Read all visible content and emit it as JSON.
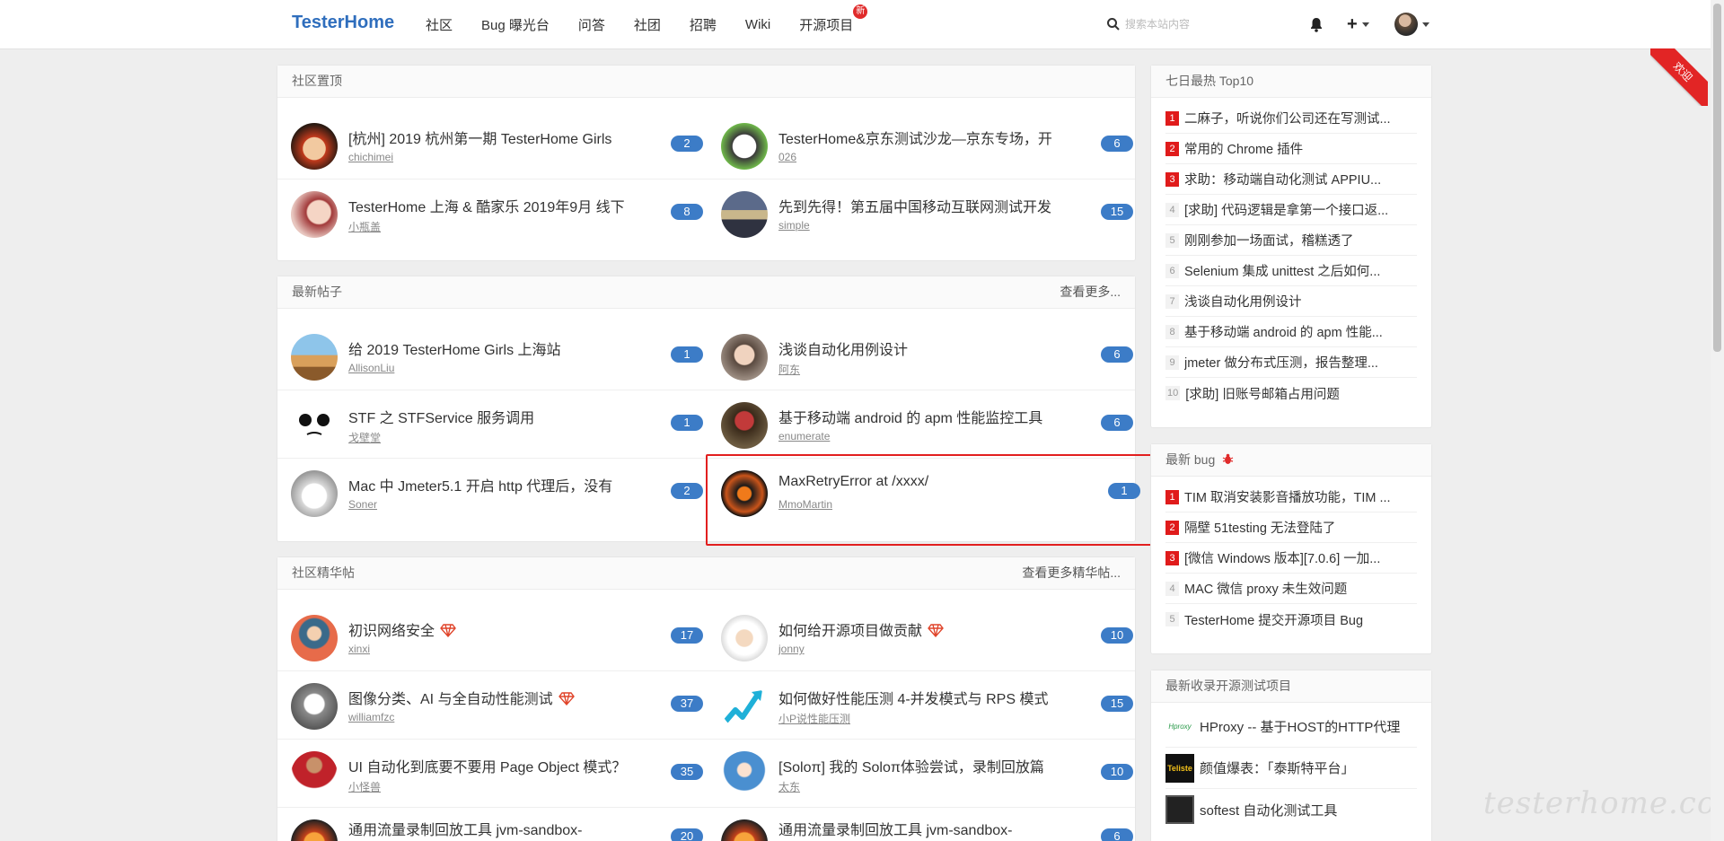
{
  "navbar": {
    "brand": "TesterHome",
    "items": [
      "社区",
      "Bug 曝光台",
      "问答",
      "社团",
      "招聘",
      "Wiki",
      "开源项目"
    ],
    "new_badge": "新",
    "search_placeholder": "搜索本站内容"
  },
  "pinned": {
    "title": "社区置顶",
    "topics": [
      {
        "title": "[杭州] 2019 杭州第一期 TesterHome Girls",
        "author": "chichimei",
        "count": "2"
      },
      {
        "title": "TesterHome&京东测试沙龙—京东专场，开",
        "author": "026",
        "count": "6"
      },
      {
        "title": "TesterHome 上海 & 酷家乐 2019年9月 线下",
        "author": "小瓶盖",
        "count": "8"
      },
      {
        "title": "先到先得！第五届中国移动互联网测试开发",
        "author": "simple",
        "count": "15"
      }
    ]
  },
  "latest": {
    "title": "最新帖子",
    "more": "查看更多...",
    "topics": [
      {
        "title": "给 2019 TesterHome Girls 上海站",
        "author": "AllisonLiu",
        "count": "1"
      },
      {
        "title": "浅谈自动化用例设计",
        "author": "阿东",
        "count": "6"
      },
      {
        "title": "STF 之 STFService 服务调用",
        "author": "戈壁堂",
        "count": "1"
      },
      {
        "title": "基于移动端 android 的 apm 性能监控工具",
        "author": "enumerate",
        "count": "6"
      },
      {
        "title": "Mac 中 Jmeter5.1 开启 http 代理后，没有",
        "author": "Soner",
        "count": "2"
      },
      {
        "title": "MaxRetryError at /xxxx/",
        "author": "MmoMartin",
        "count": "1"
      }
    ]
  },
  "excellent": {
    "title": "社区精华帖",
    "more": "查看更多精华帖...",
    "topics": [
      {
        "title": "初识网络安全",
        "author": "xinxi",
        "count": "17"
      },
      {
        "title": "如何给开源项目做贡献",
        "author": "jonny",
        "count": "10"
      },
      {
        "title": "图像分类、AI 与全自动性能测试",
        "author": "williamfzc",
        "count": "37"
      },
      {
        "title": "如何做好性能压测 4-并发模式与 RPS 模式",
        "author": "小P说性能压测",
        "count": "15"
      },
      {
        "title": "UI 自动化到底要不要用 Page Object 模式？",
        "author": "小怪兽",
        "count": "35"
      },
      {
        "title": "[Soloπ] 我的 Soloπ体验尝试，录制回放篇",
        "author": "太东",
        "count": "10"
      },
      {
        "title": "通用流量录制回放工具 jvm-sandbox-",
        "author": "",
        "count": "20"
      },
      {
        "title": "通用流量录制回放工具 jvm-sandbox-",
        "author": "",
        "count": "6"
      }
    ]
  },
  "top10": {
    "title": "七日最热 Top10",
    "items": [
      {
        "rank": "1",
        "text": "二麻子，听说你们公司还在写测试..."
      },
      {
        "rank": "2",
        "text": "常用的 Chrome 插件"
      },
      {
        "rank": "3",
        "text": "求助：移动端自动化测试 APPIU..."
      },
      {
        "rank": "4",
        "text": "[求助] 代码逻辑是拿第一个接口返..."
      },
      {
        "rank": "5",
        "text": "刚刚参加一场面试，稽糕透了"
      },
      {
        "rank": "6",
        "text": "Selenium 集成 unittest 之后如何..."
      },
      {
        "rank": "7",
        "text": "浅谈自动化用例设计"
      },
      {
        "rank": "8",
        "text": "基于移动端 android 的 apm 性能..."
      },
      {
        "rank": "9",
        "text": "jmeter 做分布式压测，报告整理..."
      },
      {
        "rank": "10",
        "text": "[求助] 旧账号邮箱占用问题"
      }
    ]
  },
  "bugs": {
    "title": "最新 bug",
    "items": [
      {
        "rank": "1",
        "text": "TIM 取消安装影音播放功能，TIM ..."
      },
      {
        "rank": "2",
        "text": "隔壁 51testing 无法登陆了"
      },
      {
        "rank": "3",
        "text": "[微信 Windows 版本][7.0.6] 一加..."
      },
      {
        "rank": "4",
        "text": "MAC 微信 proxy 未生效问题"
      },
      {
        "rank": "5",
        "text": "TesterHome 提交开源项目 Bug"
      }
    ]
  },
  "projects": {
    "title": "最新收录开源测试项目",
    "items": [
      {
        "text": "HProxy -- 基于HOST的HTTP代理",
        "logo": "Hproxy"
      },
      {
        "text": "颜值爆表：「泰斯特平台」",
        "logo": "Teliste"
      },
      {
        "text": "softest 自动化测试工具",
        "logo": ""
      }
    ]
  },
  "ribbon": "欢迎",
  "watermark": "testerhome.com",
  "colors": {
    "brand": "#2f6ebd",
    "badge": "#3c7cc7",
    "hot_rank": "#e01b1b",
    "highlight": "#e21f1f"
  }
}
